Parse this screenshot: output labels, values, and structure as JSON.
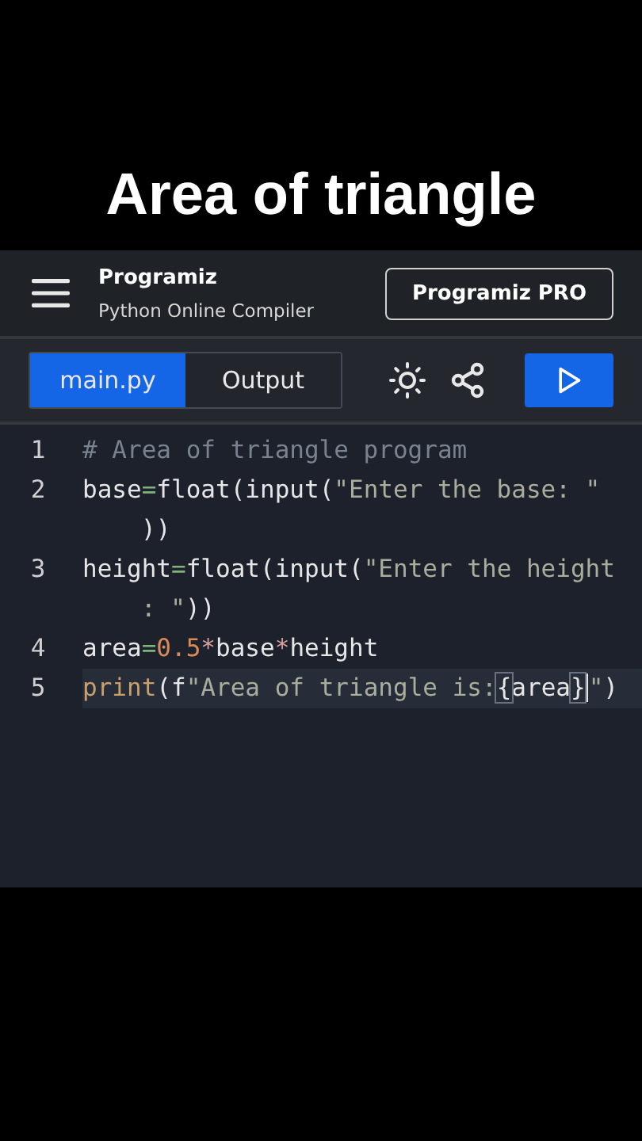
{
  "video_title": "Area of triangle",
  "header": {
    "logo": "Programiz",
    "subtitle": "Python Online Compiler",
    "pro_button": "Programiz PRO"
  },
  "tabs": [
    {
      "label": "main.py",
      "selected": true
    },
    {
      "label": "Output",
      "selected": false
    }
  ],
  "code": [
    {
      "number": "1",
      "active": false,
      "rows": [
        {
          "segments": [
            {
              "text": "# Area of triangle program",
              "kind": "comment"
            }
          ]
        }
      ]
    },
    {
      "number": "2",
      "active": false,
      "rows": [
        {
          "segments": [
            {
              "text": "base",
              "kind": "plain"
            },
            {
              "text": "=",
              "kind": "op"
            },
            {
              "text": "float(input(",
              "kind": "plain"
            },
            {
              "text": "\"Enter the base: \"",
              "kind": "string"
            }
          ]
        },
        {
          "segments": [
            {
              "text": "))",
              "kind": "plain"
            }
          ]
        }
      ]
    },
    {
      "number": "3",
      "active": false,
      "rows": [
        {
          "segments": [
            {
              "text": "height",
              "kind": "plain"
            },
            {
              "text": "=",
              "kind": "op"
            },
            {
              "text": "float(input(",
              "kind": "plain"
            },
            {
              "text": "\"Enter the height",
              "kind": "string"
            }
          ]
        },
        {
          "segments": [
            {
              "text": ": \"",
              "kind": "string"
            },
            {
              "text": "))",
              "kind": "plain"
            }
          ]
        }
      ]
    },
    {
      "number": "4",
      "active": false,
      "rows": [
        {
          "segments": [
            {
              "text": "area",
              "kind": "plain"
            },
            {
              "text": "=",
              "kind": "op"
            },
            {
              "text": "0.5",
              "kind": "number"
            },
            {
              "text": "*",
              "kind": "op2"
            },
            {
              "text": "base",
              "kind": "plain"
            },
            {
              "text": "*",
              "kind": "op2"
            },
            {
              "text": "height",
              "kind": "plain"
            }
          ]
        }
      ]
    },
    {
      "number": "5",
      "active": true,
      "rows": [
        {
          "segments": [
            {
              "text": "print",
              "kind": "builtin"
            },
            {
              "text": "(f",
              "kind": "plain"
            },
            {
              "text": "\"Area of triangle is:",
              "kind": "string"
            },
            {
              "text": "{",
              "kind": "bracket"
            },
            {
              "text": "area",
              "kind": "plain"
            },
            {
              "text": "}",
              "kind": "bracket"
            },
            {
              "text": "\"",
              "kind": "cursor"
            },
            {
              "text": ")",
              "kind": "plain"
            }
          ]
        }
      ]
    }
  ]
}
